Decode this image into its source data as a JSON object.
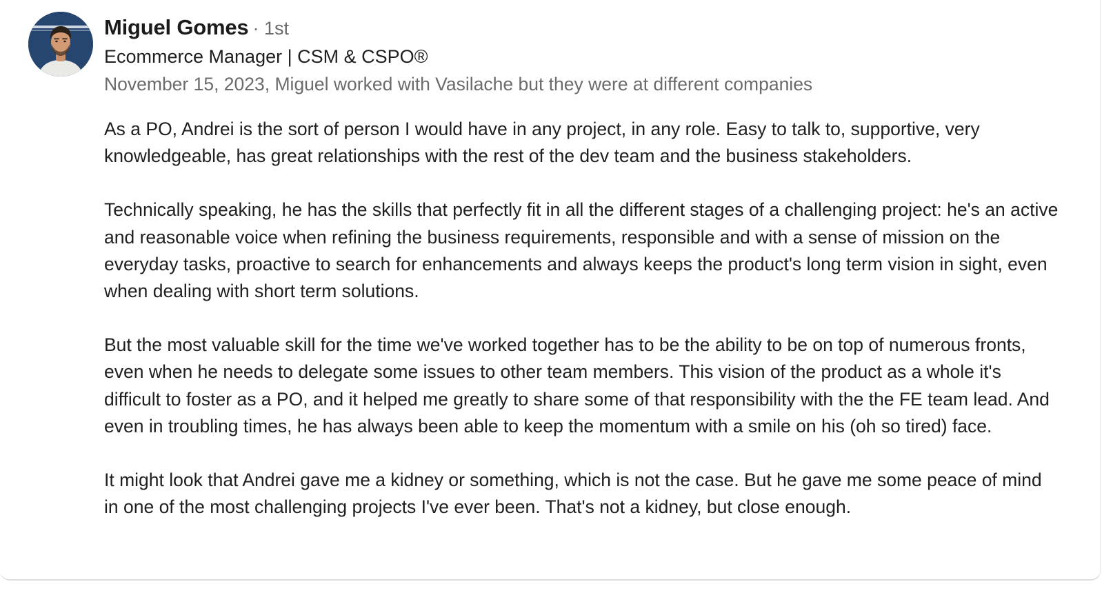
{
  "recommendation": {
    "author": {
      "name": "Miguel Gomes",
      "degree": "· 1st",
      "headline": "Ecommerce Manager | CSM & CSPO®",
      "avatar_icon": "profile-photo"
    },
    "relationship": "November 15, 2023, Miguel worked with Vasilache but they were at different companies",
    "paragraphs": [
      "As a PO, Andrei is the sort of person I would have in any project, in any role. Easy to talk to, supportive, very knowledgeable, has great relationships with the rest of the dev team and the business stakeholders.",
      "Technically speaking, he has the skills that perfectly fit in all the different stages of a challenging project: he's an active and reasonable voice when refining the business requirements, responsible and with a sense of mission on the everyday tasks, proactive to search for enhancements and always keeps the product's long term vision in sight, even when dealing with short term solutions.",
      "But the most valuable skill for the time we've worked together has to be the ability to be on top of numerous fronts, even when he needs to delegate some issues to other team members. This vision of the product as a whole it's difficult to foster as a PO, and it helped me greatly to share some of that responsibility with the the FE team lead. And even in troubling times, he has always been able to keep the momentum with a smile on his (oh so tired) face.",
      "It might look that Andrei gave me a kidney or something, which is not the case. But he gave me some peace of mind in one of the most challenging projects I've ever been. That's not a kidney, but close enough."
    ]
  },
  "colors": {
    "primary_text": "#1f1f1f",
    "secondary_text": "#6b6b6b",
    "avatar_bg": "#27466f"
  }
}
